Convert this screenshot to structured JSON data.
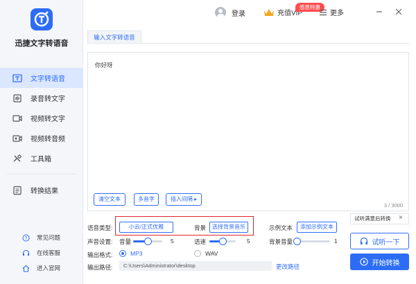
{
  "app": {
    "name": "迅捷文字转语音"
  },
  "sidebar": {
    "items": [
      {
        "label": "文字转语音",
        "icon": "text-to-speech-icon",
        "active": true
      },
      {
        "label": "录音转文字",
        "icon": "recording-icon"
      },
      {
        "label": "视频转文字",
        "icon": "video-icon"
      },
      {
        "label": "视频转音频",
        "icon": "video-audio-icon"
      },
      {
        "label": "工具箱",
        "icon": "toolbox-icon"
      }
    ],
    "result_label": "转换结果",
    "bottom": [
      {
        "label": "常见问题",
        "icon": "help-icon"
      },
      {
        "label": "在线客服",
        "icon": "headset-icon"
      },
      {
        "label": "进入官网",
        "icon": "home-icon"
      }
    ]
  },
  "topbar": {
    "login": "登录",
    "vip": "充值VIP",
    "vip_badge": "感恩特惠",
    "more": "更多"
  },
  "tab": {
    "label": "输入文字转语音"
  },
  "editor": {
    "text": "你好呀",
    "counter": "3 / 3000",
    "buttons": {
      "clear": "清空文本",
      "polyphone": "多音字",
      "pause": "插入间隔 ▸"
    }
  },
  "settings": {
    "voice_type_label": "语音类型:",
    "voice_type_value": "小云/正式优雅",
    "bg_label": "背景",
    "bg_button": "选择背景音乐",
    "sample_label": "示例文本",
    "sample_button": "添加示例文本",
    "sound_label": "声音设置:",
    "volume_label": "音量",
    "volume_value": "5",
    "speed_label": "语速",
    "speed_value": "5",
    "bg_volume_label": "背景音量",
    "bg_volume_value": "1",
    "format_label": "输出格式:",
    "formats": [
      {
        "label": "MP3",
        "checked": true
      },
      {
        "label": "WAV",
        "checked": false
      }
    ],
    "path_label": "输出路径:",
    "path_value": "C:\\Users\\Administrator\\desktop",
    "change_path": "更改路径",
    "volume_level": 0.5,
    "speed_level": 0.5,
    "bg_volume_level": 0.0
  },
  "right": {
    "tip": "试听满意后转换",
    "listen": "试听一下",
    "start": "开始转换"
  },
  "colors": {
    "accent": "#2d6df6",
    "highlight": "#e0242b",
    "badge": "#ff4d4f"
  }
}
